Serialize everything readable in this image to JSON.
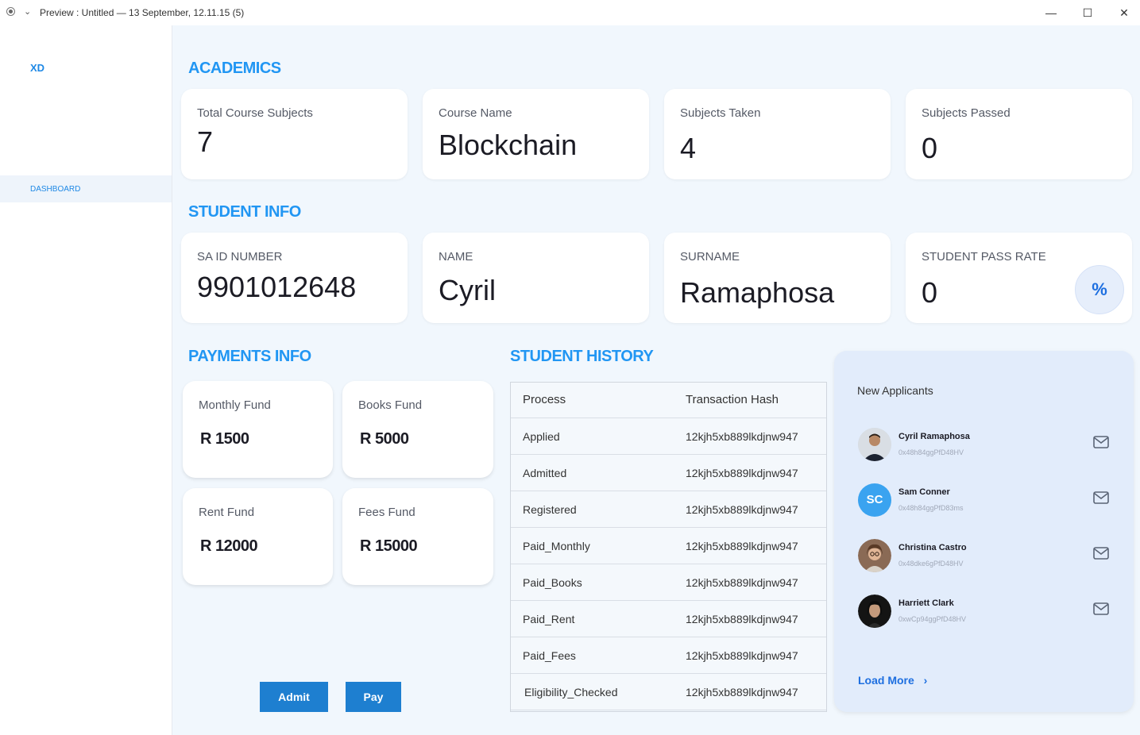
{
  "window": {
    "title": "Preview : Untitled — 13 September, 12.11.15 (5)",
    "chevron": "⌄",
    "minimize": "—",
    "maximize": "☐",
    "close": "✕"
  },
  "sidebar": {
    "logo": "XD",
    "items": [
      {
        "label": "DASHBOARD"
      }
    ]
  },
  "academics": {
    "title": "ACADEMICS",
    "cards": [
      {
        "label": "Total Course Subjects",
        "value": "7"
      },
      {
        "label": "Course Name",
        "value": "Blockchain"
      },
      {
        "label": "Subjects Taken",
        "value": "4"
      },
      {
        "label": "Subjects Passed",
        "value": "0"
      }
    ]
  },
  "student_info": {
    "title": "STUDENT INFO",
    "cards": [
      {
        "label": "SA ID NUMBER",
        "value": "9901012648"
      },
      {
        "label": "NAME",
        "value": "Cyril"
      },
      {
        "label": "SURNAME",
        "value": "Ramaphosa"
      },
      {
        "label": "STUDENT PASS RATE",
        "value": "0",
        "icon": "percent-icon",
        "icon_glyph": "%"
      }
    ]
  },
  "payments": {
    "title": "PAYMENTS INFO",
    "cards": [
      {
        "label": "Monthly Fund",
        "value": "R 1500"
      },
      {
        "label": "Books Fund",
        "value": "R 5000"
      },
      {
        "label": "Rent Fund",
        "value": "R 12000"
      },
      {
        "label": "Fees Fund",
        "value": "R 15000"
      }
    ],
    "buttons": {
      "admit": "Admit",
      "pay": "Pay"
    }
  },
  "history": {
    "title": "STUDENT HISTORY",
    "columns": [
      "Process",
      "Transaction Hash"
    ],
    "rows": [
      [
        "Applied",
        "12kjh5xb889lkdjnw947"
      ],
      [
        "Admitted",
        "12kjh5xb889lkdjnw947"
      ],
      [
        "Registered",
        "12kjh5xb889lkdjnw947"
      ],
      [
        "Paid_Monthly",
        "12kjh5xb889lkdjnw947"
      ],
      [
        "Paid_Books",
        "12kjh5xb889lkdjnw947"
      ],
      [
        "Paid_Rent",
        "12kjh5xb889lkdjnw947"
      ],
      [
        "Paid_Fees",
        "12kjh5xb889lkdjnw947"
      ],
      [
        "Eligibility_Checked",
        "12kjh5xb889lkdjnw947"
      ]
    ]
  },
  "applicants": {
    "title": "New Applicants",
    "items": [
      {
        "name": "Cyril Ramaphosa",
        "hash": "0x48h84ggPfD48HV",
        "avatar": "photo"
      },
      {
        "name": "Sam Conner",
        "hash": "0x48h84ggPfD83ms",
        "avatar": "initials",
        "initials": "SC"
      },
      {
        "name": "Christina Castro",
        "hash": "0x48dke6gPfD48HV",
        "avatar": "photo"
      },
      {
        "name": "Harriett Clark",
        "hash": "0xwCp94ggPfD48HV",
        "avatar": "photo"
      }
    ],
    "load_more": "Load More",
    "load_more_icon": "›"
  },
  "colors": {
    "accent": "#2196f3",
    "background": "#f1f7fd",
    "button": "#1e7fd0",
    "applicants_panel": "#e2ecfb"
  }
}
